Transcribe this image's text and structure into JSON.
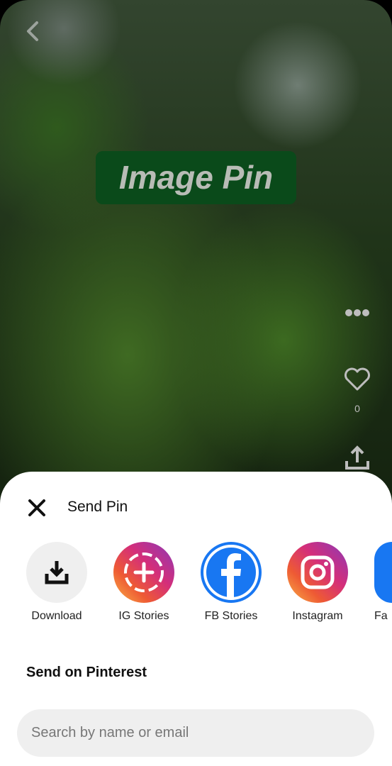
{
  "pin": {
    "overlay_text": "Image Pin",
    "like_count": "0"
  },
  "sheet": {
    "title": "Send Pin",
    "share_options": [
      {
        "label": "Download",
        "icon": "download-icon"
      },
      {
        "label": "IG Stories",
        "icon": "instagram-stories-icon"
      },
      {
        "label": "FB Stories",
        "icon": "facebook-icon"
      },
      {
        "label": "Instagram",
        "icon": "instagram-icon"
      },
      {
        "label": "Fa",
        "icon": "facebook-icon"
      }
    ],
    "section_title": "Send on Pinterest",
    "search_placeholder": "Search by name or email"
  },
  "colors": {
    "facebook": "#1877f2",
    "pin_label_bg": "#0a4a1a",
    "search_bg": "#efefef"
  }
}
